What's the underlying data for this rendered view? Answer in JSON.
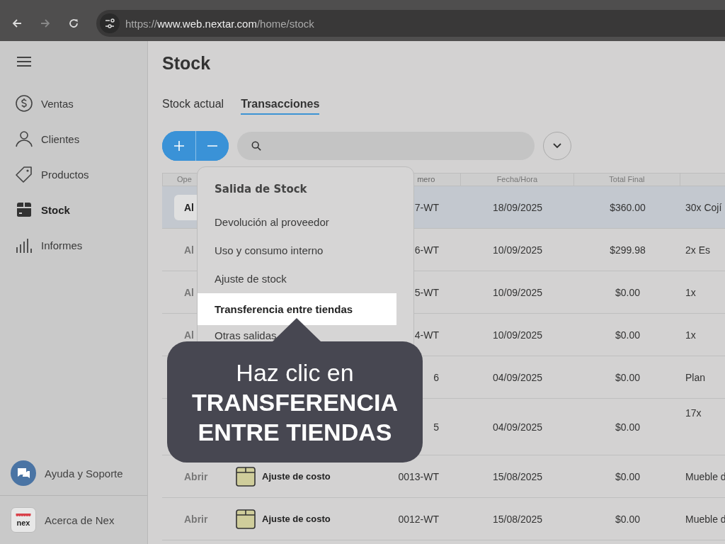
{
  "browser": {
    "url_scheme": "https://",
    "url_host": "www.web.nextar.com",
    "url_path": "/home/stock"
  },
  "sidebar": {
    "items": [
      {
        "label": "Ventas",
        "kind": "dollar",
        "selected": false
      },
      {
        "label": "Clientes",
        "kind": "person",
        "selected": false
      },
      {
        "label": "Productos",
        "kind": "tag",
        "selected": false
      },
      {
        "label": "Stock",
        "kind": "box",
        "selected": true
      },
      {
        "label": "Informes",
        "kind": "bars",
        "selected": false
      }
    ],
    "help": {
      "label": "Ayuda y Soporte"
    },
    "about": {
      "label": "Acerca de Nex",
      "logo_text": "nex"
    }
  },
  "page": {
    "title": "Stock"
  },
  "tabs": [
    {
      "label": "Stock actual",
      "selected": false
    },
    {
      "label": "Transacciones",
      "selected": true
    }
  ],
  "table": {
    "columns": [
      {
        "label": "Ope"
      },
      {},
      {
        "label": "mero"
      },
      {
        "label": "Fecha/Hora"
      },
      {
        "label": "Total Final"
      },
      {}
    ],
    "rows": [
      {
        "selected": true,
        "open": "Al",
        "number": "7-WT",
        "date": "18/09/2025",
        "total": "$360.00",
        "description": "30x Cojí"
      },
      {
        "selected": false,
        "open": "Al",
        "number": "6-WT",
        "date": "10/09/2025",
        "total": "$299.98",
        "description": "2x Es"
      },
      {
        "selected": false,
        "open": "Al",
        "number": "5-WT",
        "date": "10/09/2025",
        "total": "$0.00",
        "description": "1x"
      },
      {
        "selected": false,
        "open": "Al",
        "number": "4-WT",
        "date": "10/09/2025",
        "total": "$0.00",
        "description": "1x"
      },
      {
        "selected": false,
        "number": "6",
        "date": "04/09/2025",
        "total": "$0.00",
        "description": "Plan"
      },
      {
        "selected": false,
        "tall": true,
        "number": "5",
        "date": "04/09/2025",
        "total": "$0.00",
        "description": "17x"
      },
      {
        "selected": false,
        "open": "Abrir",
        "type": "Ajuste de costo",
        "number": "0013-WT",
        "date": "15/08/2025",
        "total": "$0.00",
        "description": "Mueble d"
      },
      {
        "selected": false,
        "open": "Abrir",
        "type": "Ajuste de costo",
        "number": "0012-WT",
        "date": "15/08/2025",
        "total": "$0.00",
        "description": "Mueble d"
      }
    ]
  },
  "menu": {
    "title": "Salida de Stock",
    "items": [
      {
        "label": "Devolución al proveedor",
        "selected": false
      },
      {
        "label": "Uso y consumo interno",
        "selected": false
      },
      {
        "label": "Ajuste de stock",
        "selected": false
      },
      {
        "label": "Transferencia entre tiendas",
        "selected": true
      },
      {
        "label": "Otras salidas",
        "selected": false
      }
    ]
  },
  "callout": {
    "text": "Haz clic en **TRANSFERENCIA ENTRE TIENDAS**"
  }
}
